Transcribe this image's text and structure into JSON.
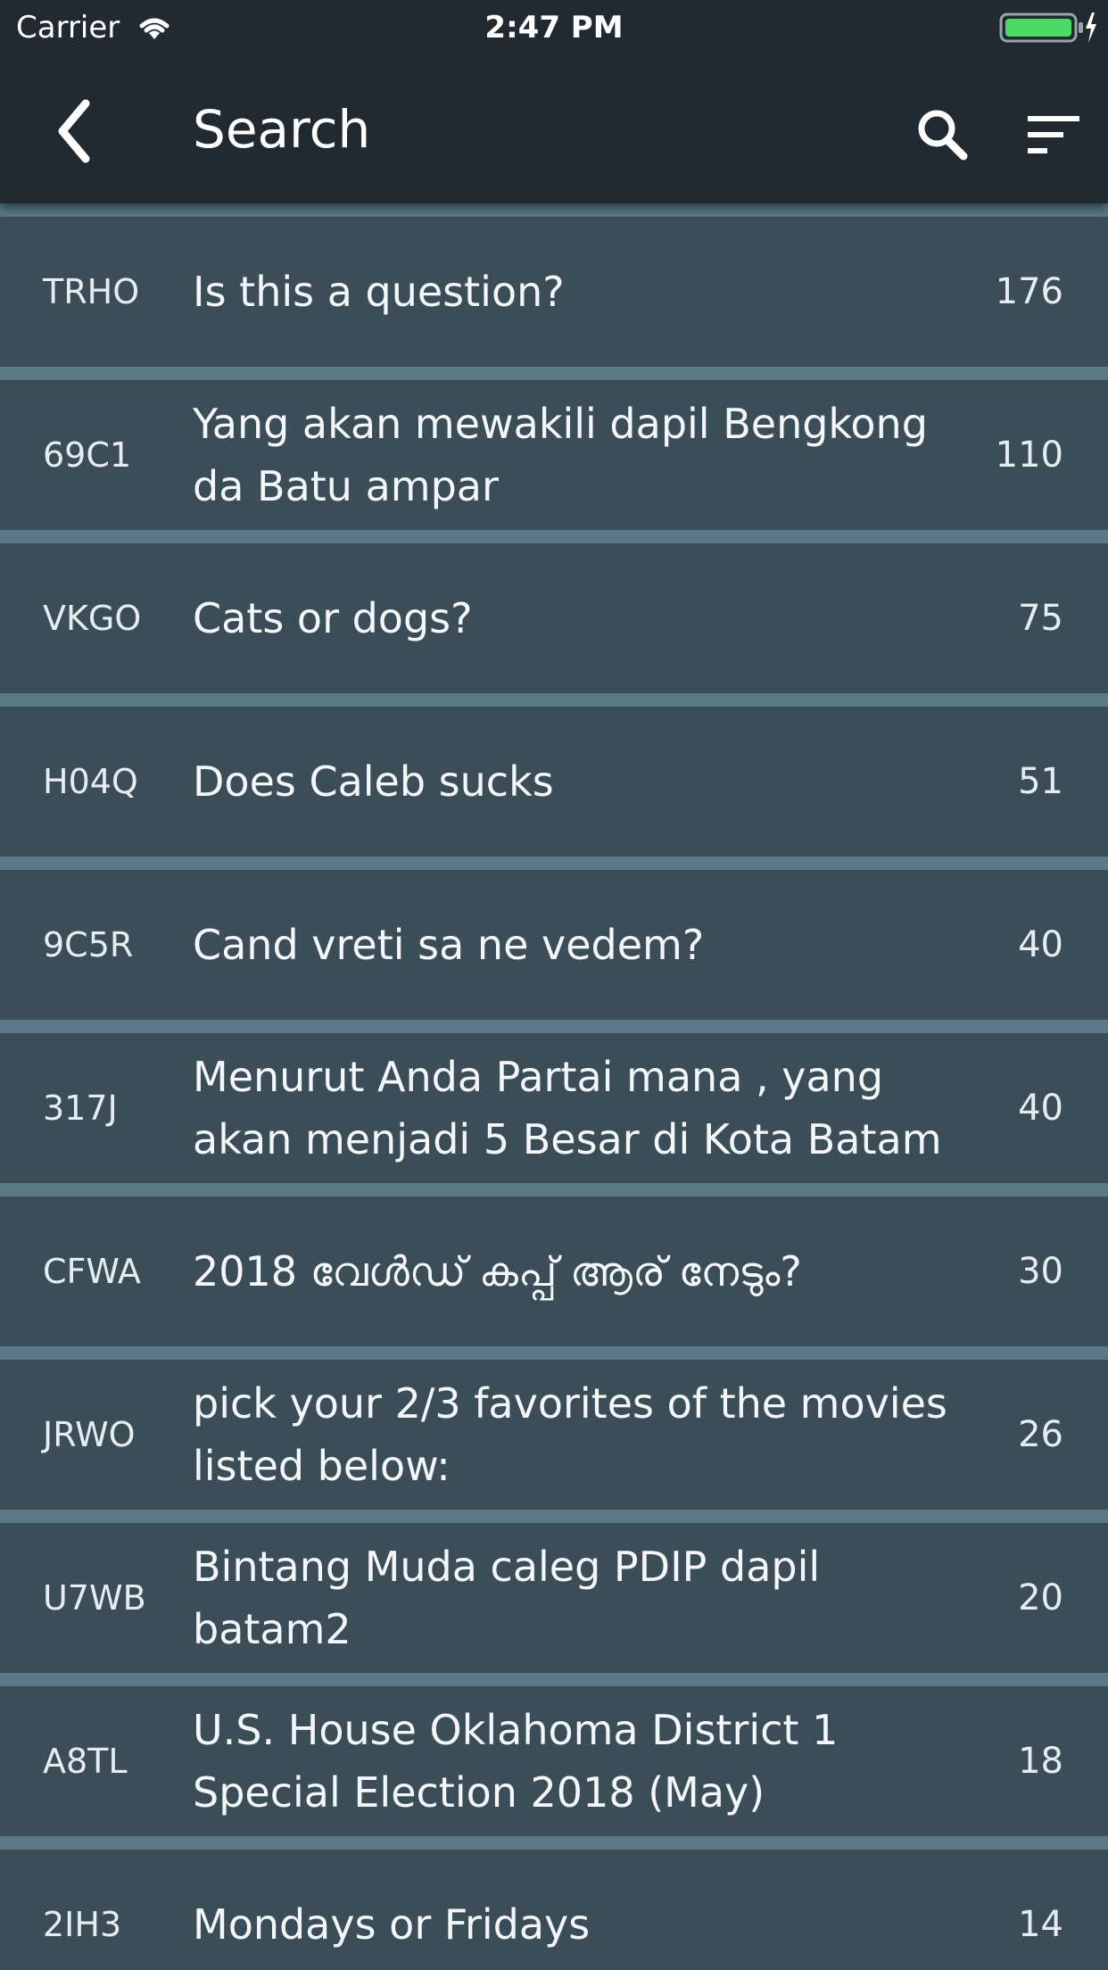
{
  "status_bar": {
    "carrier": "Carrier",
    "time": "2:47 PM",
    "battery_color": "#4cd964"
  },
  "nav": {
    "title": "Search",
    "back_icon": "chevron-left-icon",
    "search_icon": "search-icon",
    "sort_icon": "sort-icon"
  },
  "colors": {
    "header_bg": "#212a31",
    "row_bg": "#3b4d57",
    "separator": "#5b7889"
  },
  "polls": [
    {
      "code": "TRHO",
      "question": "Is this a question?",
      "count": "176"
    },
    {
      "code": "69C1",
      "question": "Yang akan mewakili dapil Bengkong da  Batu ampar",
      "count": "110"
    },
    {
      "code": "VKGO",
      "question": "Cats or dogs?",
      "count": "75"
    },
    {
      "code": "H04Q",
      "question": "Does Caleb sucks",
      "count": "51"
    },
    {
      "code": "9C5R",
      "question": "Cand vreti sa ne vedem?",
      "count": "40"
    },
    {
      "code": "317J",
      "question": "Menurut Anda Partai mana , yang akan menjadi 5 Besar di Kota Batam",
      "count": "40"
    },
    {
      "code": "CFWA",
      "question": "2018 വേൾഡ് കപ്പ് ആര് നേടും?",
      "count": "30"
    },
    {
      "code": "JRWO",
      "question": "pick your 2/3 favorites of the movies listed below:",
      "count": "26"
    },
    {
      "code": "U7WB",
      "question": "Bintang Muda caleg PDIP dapil batam2",
      "count": "20"
    },
    {
      "code": "A8TL",
      "question": "U.S. House Oklahoma District 1 Special Election 2018 (May)",
      "count": "18"
    },
    {
      "code": "2IH3",
      "question": "Mondays or Fridays",
      "count": "14"
    }
  ]
}
